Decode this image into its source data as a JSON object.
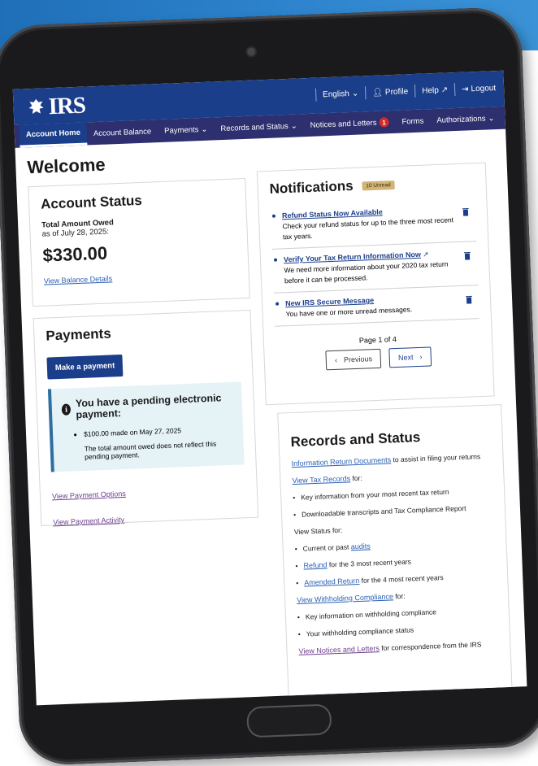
{
  "header": {
    "logo_text": "IRS",
    "language": "English",
    "profile": "Profile",
    "help": "Help",
    "logout": "Logout"
  },
  "nav": {
    "items": [
      {
        "label": "Account Home"
      },
      {
        "label": "Account Balance"
      },
      {
        "label": "Payments"
      },
      {
        "label": "Records and Status"
      },
      {
        "label": "Notices and Letters"
      },
      {
        "label": "Forms"
      },
      {
        "label": "Authorizations"
      }
    ],
    "notices_count": "1"
  },
  "page": {
    "title": "Welcome"
  },
  "account_status": {
    "title": "Account Status",
    "owed_label": "Total Amount Owed",
    "as_of": "as of July 28, 2025:",
    "amount": "$330.00",
    "link": "View Balance Details"
  },
  "payments": {
    "title": "Payments",
    "button": "Make a payment",
    "pending_title": "You have a pending electronic payment:",
    "pending_item": "$100.00 made on May 27, 2025",
    "pending_note": "The total amount owed does not reflect this pending payment.",
    "link_options": "View Payment Options",
    "link_activity": "View Payment Activity"
  },
  "notifications": {
    "title": "Notifications",
    "unread_badge": "10 Unread",
    "items": [
      {
        "title": "Refund Status Now Available",
        "body": "Check your refund status for up to the three most recent tax years."
      },
      {
        "title": "Verify Your Tax Return Information Now",
        "body": "We need more information about your 2020 tax return before it can be processed."
      },
      {
        "title": "New IRS Secure Message",
        "body": "You have one or more unread messages."
      }
    ],
    "page_label": "Page 1 of 4",
    "prev": "Previous",
    "next": "Next"
  },
  "records": {
    "title": "Records and Status",
    "info_link": "Information Return Documents",
    "info_rest": " to assist in filing your returns",
    "tax_records_link": "View Tax Records",
    "tax_records_rest": " for:",
    "tax_bullet1": "Key information from your most recent tax return",
    "tax_bullet2": "Downloadable transcripts and Tax Compliance Report",
    "view_status": "View Status for:",
    "audits_pre": "Current or past ",
    "audits_link": "audits",
    "refund_link": "Refund",
    "refund_rest": " for the 3 most recent years",
    "amended_link": "Amended Return",
    "amended_rest": " for the 4 most recent years",
    "withholding_link": "View Withholding Compliance",
    "withholding_rest": " for:",
    "wh_bullet1": "Key information on withholding compliance",
    "wh_bullet2": "Your withholding compliance status",
    "notices_link": "View Notices and Letters",
    "notices_rest": " for correspondence from the IRS"
  }
}
